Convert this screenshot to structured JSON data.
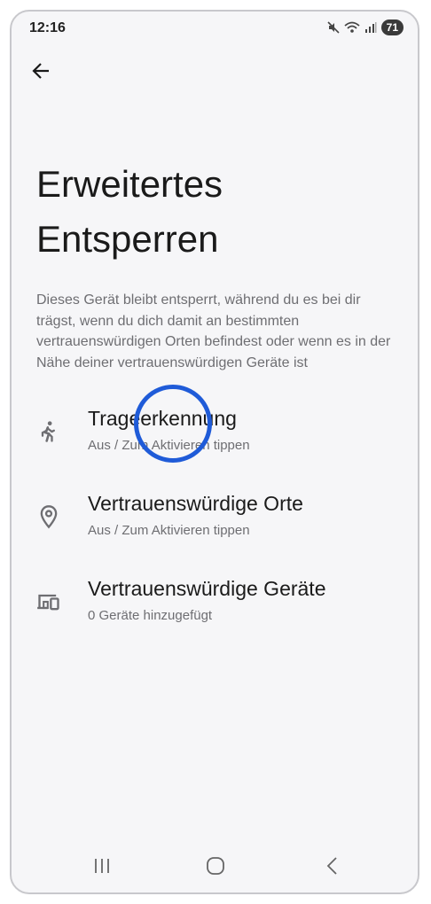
{
  "status_bar": {
    "time": "12:16",
    "battery": "71"
  },
  "page": {
    "title_line1": "Erweitertes",
    "title_line2": "Entsperren",
    "description": "Dieses Gerät bleibt entsperrt, während du es bei dir trägst, wenn du dich damit an bestimmten vertrauenswürdigen Orten befindest oder wenn es in der Nähe deiner vertrauenswürdigen Geräte ist"
  },
  "settings": [
    {
      "label": "Trageerkennung",
      "sub": "Aus / Zum Aktivieren tippen",
      "icon": "walking-person-icon"
    },
    {
      "label": "Vertrauenswürdige Orte",
      "sub": "Aus / Zum Aktivieren tippen",
      "icon": "location-pin-icon"
    },
    {
      "label": "Vertrauenswürdige Geräte",
      "sub": "0 Geräte hinzugefügt",
      "icon": "devices-icon"
    }
  ]
}
